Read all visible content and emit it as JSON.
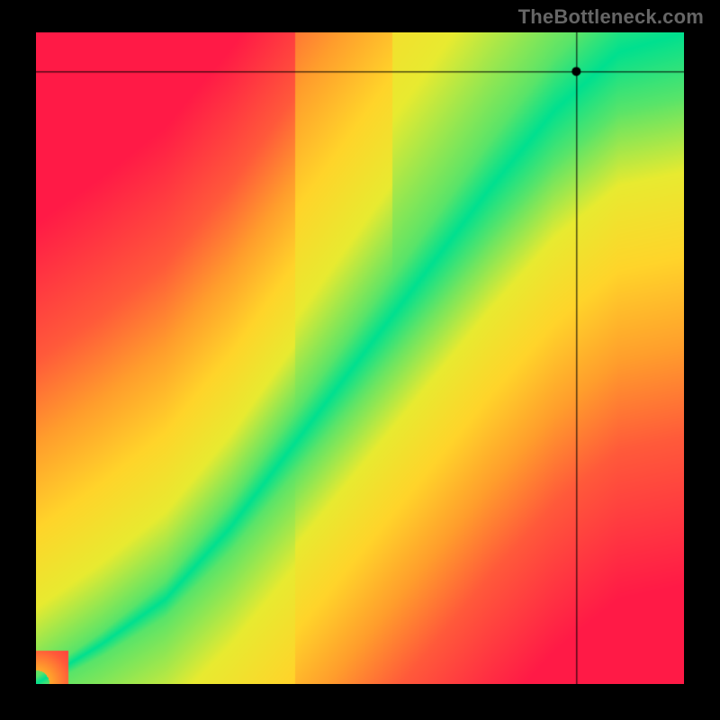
{
  "attribution": "TheBottleneck.com",
  "chart_data": {
    "type": "heatmap",
    "title": "",
    "xlabel": "",
    "ylabel": "",
    "xlim": [
      0,
      1
    ],
    "ylim": [
      0,
      1
    ],
    "ridge": {
      "description": "Green optimal band follows a slightly convex diagonal from bottom-left to top-right",
      "points": [
        {
          "x": 0.0,
          "y": 0.0
        },
        {
          "x": 0.1,
          "y": 0.06
        },
        {
          "x": 0.2,
          "y": 0.13
        },
        {
          "x": 0.3,
          "y": 0.24
        },
        {
          "x": 0.4,
          "y": 0.37
        },
        {
          "x": 0.5,
          "y": 0.5
        },
        {
          "x": 0.6,
          "y": 0.63
        },
        {
          "x": 0.7,
          "y": 0.76
        },
        {
          "x": 0.8,
          "y": 0.88
        },
        {
          "x": 0.9,
          "y": 0.97
        },
        {
          "x": 1.0,
          "y": 1.0
        }
      ],
      "width_start": 0.01,
      "width_end": 0.1
    },
    "crosshair": {
      "x": 0.835,
      "y": 0.94
    },
    "color_stops": [
      {
        "t": 0.0,
        "color": "#00e08f"
      },
      {
        "t": 0.1,
        "color": "#6fe560"
      },
      {
        "t": 0.22,
        "color": "#e8ea30"
      },
      {
        "t": 0.38,
        "color": "#ffd42a"
      },
      {
        "t": 0.55,
        "color": "#ff9e2c"
      },
      {
        "t": 0.72,
        "color": "#ff5a3a"
      },
      {
        "t": 1.0,
        "color": "#ff1a46"
      }
    ]
  }
}
